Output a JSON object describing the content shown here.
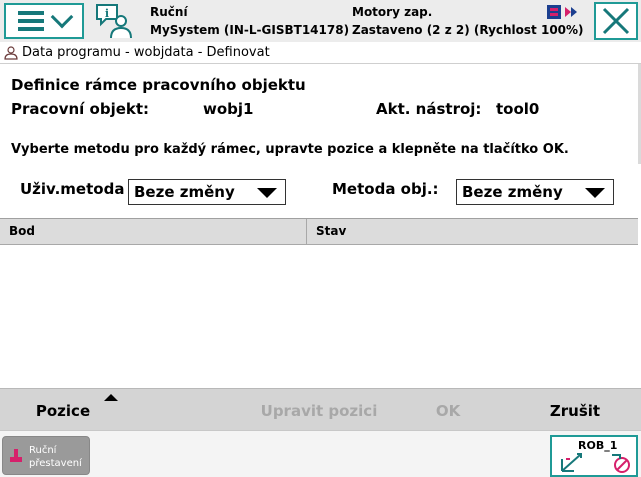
{
  "status": {
    "mode": "Ruční",
    "system": "MySystem (IN-L-GISBT14178)",
    "motors": "Motory zap.",
    "state": "Zastaveno (2 z 2) (Rychlost 100%)"
  },
  "window": {
    "title": "Data programu - wobjdata - Definovat"
  },
  "main": {
    "heading": "Definice rámce pracovního objektu",
    "workobject_label": "Pracovní objekt:",
    "workobject_value": "wobj1",
    "tool_label": "Akt. nástroj:",
    "tool_value": "tool0",
    "instruction": "Vyberte metodu pro každý rámec, upravte pozice a klepněte na tlačítko OK.",
    "user_method_label": "Uživ.metoda",
    "user_method_value": "Beze změny",
    "object_method_label": "Metoda obj.:",
    "object_method_value": "Beze změny"
  },
  "table": {
    "columns": [
      "Bod",
      "Stav"
    ],
    "rows": []
  },
  "commands": {
    "positions": "Pozice",
    "modify_position": "Upravit pozici",
    "ok": "OK",
    "cancel": "Zrušit"
  },
  "bottom": {
    "jog_line1": "Ruční",
    "jog_line2": "přestavení",
    "robot": "ROB_1"
  },
  "colors": {
    "accent": "#1f9a96",
    "disabled_text": "#a8a8a8",
    "command_bar": "#d4d4d4"
  }
}
